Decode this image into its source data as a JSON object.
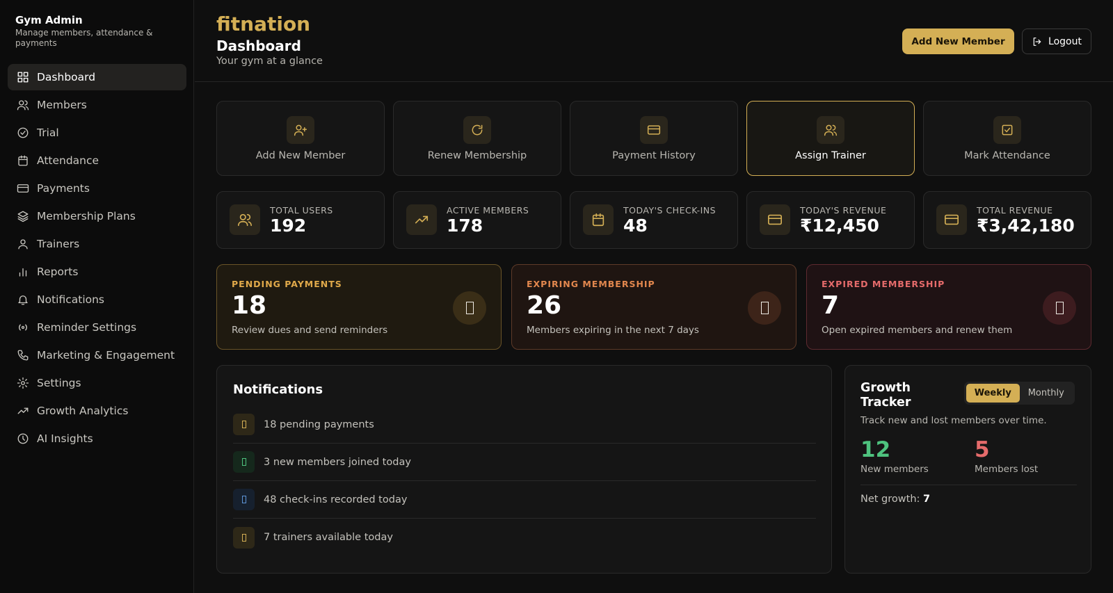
{
  "sidebar": {
    "title": "Gym Admin",
    "subtitle": "Manage members, attendance & payments",
    "items": [
      {
        "label": "Dashboard",
        "icon": "grid-icon"
      },
      {
        "label": "Members",
        "icon": "users-icon"
      },
      {
        "label": "Trial",
        "icon": "check-circle-icon"
      },
      {
        "label": "Attendance",
        "icon": "calendar-icon"
      },
      {
        "label": "Payments",
        "icon": "credit-card-icon"
      },
      {
        "label": "Membership Plans",
        "icon": "layers-icon"
      },
      {
        "label": "Trainers",
        "icon": "user-icon"
      },
      {
        "label": "Reports",
        "icon": "bar-chart-icon"
      },
      {
        "label": "Notifications",
        "icon": "bell-icon"
      },
      {
        "label": "Reminder Settings",
        "icon": "broadcast-icon"
      },
      {
        "label": "Marketing & Engagement",
        "icon": "phone-icon"
      },
      {
        "label": "Settings",
        "icon": "gear-icon"
      },
      {
        "label": "Growth Analytics",
        "icon": "trending-up-icon"
      },
      {
        "label": "AI Insights",
        "icon": "clock-icon"
      }
    ],
    "active": "Dashboard"
  },
  "header": {
    "brand": "fitnation",
    "title": "Dashboard",
    "subtitle": "Your gym at a glance",
    "add_button": "Add New Member",
    "logout_button": "Logout"
  },
  "quick_actions": [
    {
      "label": "Add New Member",
      "icon": "user-plus-icon"
    },
    {
      "label": "Renew Membership",
      "icon": "refresh-icon"
    },
    {
      "label": "Payment History",
      "icon": "credit-card-icon"
    },
    {
      "label": "Assign Trainer",
      "icon": "users-icon"
    },
    {
      "label": "Mark Attendance",
      "icon": "check-square-icon"
    }
  ],
  "quick_action_selected": "Assign Trainer",
  "stats": [
    {
      "label": "TOTAL USERS",
      "value": "192",
      "icon": "users-icon"
    },
    {
      "label": "ACTIVE MEMBERS",
      "value": "178",
      "icon": "trending-up-icon"
    },
    {
      "label": "TODAY'S CHECK-INS",
      "value": "48",
      "icon": "calendar-icon"
    },
    {
      "label": "TODAY'S REVENUE",
      "value": "₹12,450",
      "icon": "credit-card-icon"
    },
    {
      "label": "TOTAL REVENUE",
      "value": "₹3,42,180",
      "icon": "credit-card-icon"
    }
  ],
  "alerts": [
    {
      "title": "PENDING PAYMENTS",
      "value": "18",
      "desc": "Review dues and send reminders",
      "color": "#e0a94a"
    },
    {
      "title": "EXPIRING MEMBERSHIP",
      "value": "26",
      "desc": "Members expiring in the next 7 days",
      "color": "#e2874e"
    },
    {
      "title": "EXPIRED MEMBERSHIP",
      "value": "7",
      "desc": "Open expired members and renew them",
      "color": "#e56b6b"
    }
  ],
  "notifications": {
    "title": "Notifications",
    "items": [
      {
        "text": "18 pending payments",
        "color": "#d4af55"
      },
      {
        "text": "3 new members joined today",
        "color": "#4ec27e"
      },
      {
        "text": "48 check-ins recorded today",
        "color": "#5e95d8"
      },
      {
        "text": "7 trainers available today",
        "color": "#d4af55"
      }
    ]
  },
  "growth": {
    "title": "Growth Tracker",
    "toggle": [
      "Weekly",
      "Monthly"
    ],
    "toggle_selected": "Weekly",
    "subtitle": "Track new and lost members over time.",
    "new_value": "12",
    "new_label": "New members",
    "lost_value": "5",
    "lost_label": "Members lost",
    "net_label": "Net growth:",
    "net_value": "7"
  },
  "colors": {
    "accent": "#d4af55",
    "background": "#0f0f0f",
    "positive": "#4ec27e",
    "negative": "#e56b6b"
  }
}
